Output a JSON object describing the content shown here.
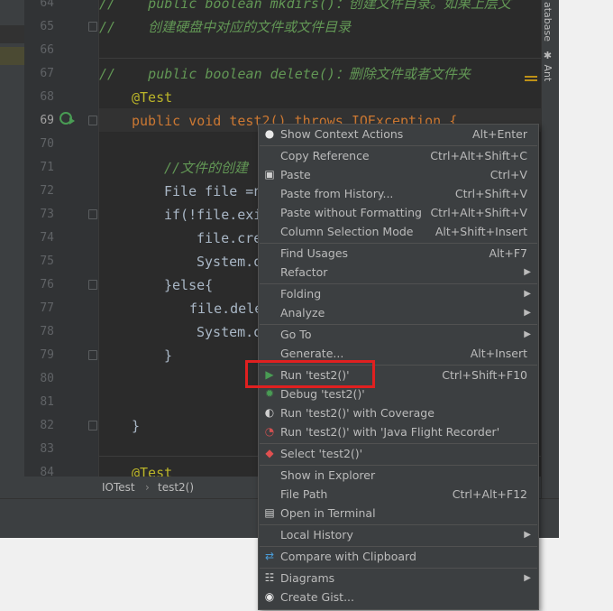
{
  "editor": {
    "lines": [
      {
        "num": "64",
        "text": "//    public boolean mkdirs()：创建文件目录。如果上层文"
      },
      {
        "num": "65",
        "text": "//    创建硬盘中对应的文件或文件目录"
      },
      {
        "num": "66",
        "text": ""
      },
      {
        "num": "67",
        "text": "//    public boolean delete()：删除文件或者文件夹"
      },
      {
        "num": "68",
        "text": "@Test"
      },
      {
        "num": "69",
        "text": "public void test2() throws IOException {"
      },
      {
        "num": "70",
        "text": ""
      },
      {
        "num": "71",
        "text": "//文件的创建"
      },
      {
        "num": "72",
        "text": "File file =n"
      },
      {
        "num": "73",
        "text": "if(!file.exi"
      },
      {
        "num": "74",
        "text": "file.cre"
      },
      {
        "num": "75",
        "text": "System.o"
      },
      {
        "num": "76",
        "text": "}else{"
      },
      {
        "num": "77",
        "text": "file.dele"
      },
      {
        "num": "78",
        "text": "System.o"
      },
      {
        "num": "79",
        "text": "}"
      },
      {
        "num": "80",
        "text": ""
      },
      {
        "num": "81",
        "text": ""
      },
      {
        "num": "82",
        "text": "}"
      },
      {
        "num": "83",
        "text": ""
      },
      {
        "num": "84",
        "text": "@Test"
      }
    ]
  },
  "breadcrumb": {
    "class_name": "IOTest",
    "separator": "›",
    "method": "test2()"
  },
  "right_toolbar": {
    "database": "atabase",
    "ant": "Ant"
  },
  "context_menu": {
    "items": [
      {
        "label": "Show Context Actions",
        "shortcut": "Alt+Enter",
        "icon": "lightbulb-icon"
      },
      {
        "label": "Copy Reference",
        "shortcut": "Ctrl+Alt+Shift+C",
        "icon": ""
      },
      {
        "label": "Paste",
        "shortcut": "Ctrl+V",
        "icon": "clipboard-icon"
      },
      {
        "label": "Paste from History...",
        "shortcut": "Ctrl+Shift+V",
        "icon": ""
      },
      {
        "label": "Paste without Formatting",
        "shortcut": "Ctrl+Alt+Shift+V",
        "icon": ""
      },
      {
        "label": "Column Selection Mode",
        "shortcut": "Alt+Shift+Insert",
        "icon": ""
      },
      {
        "label": "Find Usages",
        "shortcut": "Alt+F7",
        "icon": ""
      },
      {
        "label": "Refactor",
        "shortcut": "",
        "icon": ""
      },
      {
        "label": "Folding",
        "shortcut": "",
        "icon": ""
      },
      {
        "label": "Analyze",
        "shortcut": "",
        "icon": ""
      },
      {
        "label": "Go To",
        "shortcut": "",
        "icon": ""
      },
      {
        "label": "Generate...",
        "shortcut": "Alt+Insert",
        "icon": ""
      },
      {
        "label": "Run 'test2()'",
        "shortcut": "Ctrl+Shift+F10",
        "icon": "run-icon"
      },
      {
        "label": "Debug 'test2()'",
        "shortcut": "",
        "icon": "debug-icon"
      },
      {
        "label": "Run 'test2()' with Coverage",
        "shortcut": "",
        "icon": "coverage-icon"
      },
      {
        "label": "Run 'test2()' with 'Java Flight Recorder'",
        "shortcut": "",
        "icon": "flight-recorder-icon"
      },
      {
        "label": "Select 'test2()'",
        "shortcut": "",
        "icon": "select-icon"
      },
      {
        "label": "Show in Explorer",
        "shortcut": "",
        "icon": ""
      },
      {
        "label": "File Path",
        "shortcut": "Ctrl+Alt+F12",
        "icon": ""
      },
      {
        "label": "Open in Terminal",
        "shortcut": "",
        "icon": "terminal-icon"
      },
      {
        "label": "Local History",
        "shortcut": "",
        "icon": ""
      },
      {
        "label": "Compare with Clipboard",
        "shortcut": "",
        "icon": "compare-icon"
      },
      {
        "label": "Diagrams",
        "shortcut": "",
        "icon": "diagram-icon"
      },
      {
        "label": "Create Gist...",
        "shortcut": "",
        "icon": "github-icon"
      }
    ]
  },
  "colors": {
    "accent_highlight": "#e02020",
    "run_green": "#499c54"
  }
}
